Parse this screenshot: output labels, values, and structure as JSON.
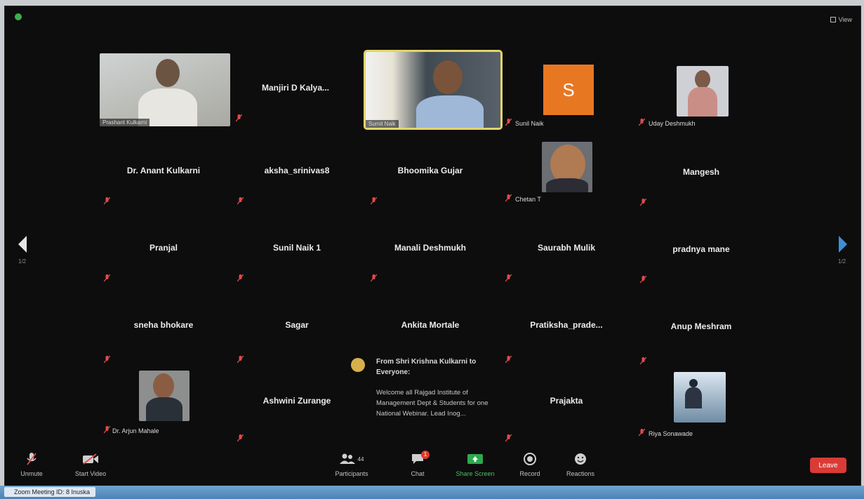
{
  "window": {
    "view_label": "View"
  },
  "participants": [
    {
      "name": "Prashant Kulkarni",
      "kind": "video"
    },
    {
      "name": "Manjiri D Kalya...",
      "kind": "name"
    },
    {
      "name": "Sumit Naik",
      "kind": "video"
    },
    {
      "name": "Sunil Naik",
      "kind": "avatar",
      "initial": "S"
    },
    {
      "name": "Uday Deshmukh",
      "kind": "video"
    },
    {
      "name": "Dr. Anant Kulkarni",
      "kind": "name"
    },
    {
      "name": "aksha_srinivas8",
      "kind": "name"
    },
    {
      "name": "Bhoomika Gujar",
      "kind": "name"
    },
    {
      "name": "Chetan T",
      "kind": "video"
    },
    {
      "name": "Mangesh",
      "kind": "name"
    },
    {
      "name": "Pranjal",
      "kind": "name"
    },
    {
      "name": "Sunil Naik 1",
      "kind": "name"
    },
    {
      "name": "Manali Deshmukh",
      "kind": "name"
    },
    {
      "name": "Saurabh Mulik",
      "kind": "name"
    },
    {
      "name": "pradnya mane",
      "kind": "name"
    },
    {
      "name": "sneha bhokare",
      "kind": "name"
    },
    {
      "name": "Sagar",
      "kind": "name"
    },
    {
      "name": "Ankita Mortale",
      "kind": "name"
    },
    {
      "name": "Pratiksha_prade...",
      "kind": "name"
    },
    {
      "name": "Anup Meshram",
      "kind": "name"
    },
    {
      "name": "Dr. Arjun Mahale",
      "kind": "video"
    },
    {
      "name": "Ashwini Zurange",
      "kind": "name"
    },
    {
      "name": "Prajakta",
      "kind": "name"
    },
    {
      "name": "Riya Sonawade",
      "kind": "video"
    }
  ],
  "chat_popup": {
    "from": "From Shri Krishna Kulkarni to Everyone:",
    "message": "Welcome all Rajgad Institute of Management Dept & Students for one National Webinar. Lead Inog..."
  },
  "pager": {
    "left": "1/2",
    "right": "1/2"
  },
  "toolbar": {
    "unmute": "Unmute",
    "start_video": "Start Video",
    "participants": "Participants",
    "participants_count": "44",
    "chat": "Chat",
    "chat_badge": "1",
    "share_screen": "Share Screen",
    "record": "Record",
    "reactions": "Reactions",
    "end": "Leave"
  },
  "taskbar": {
    "title": "Zoom Meeting ID: 8 Inuska"
  },
  "colors": {
    "background": "#0d0d0d",
    "active_speaker": "#e3d46a",
    "avatar_s": "#e87722",
    "end_button": "#d93b36"
  }
}
